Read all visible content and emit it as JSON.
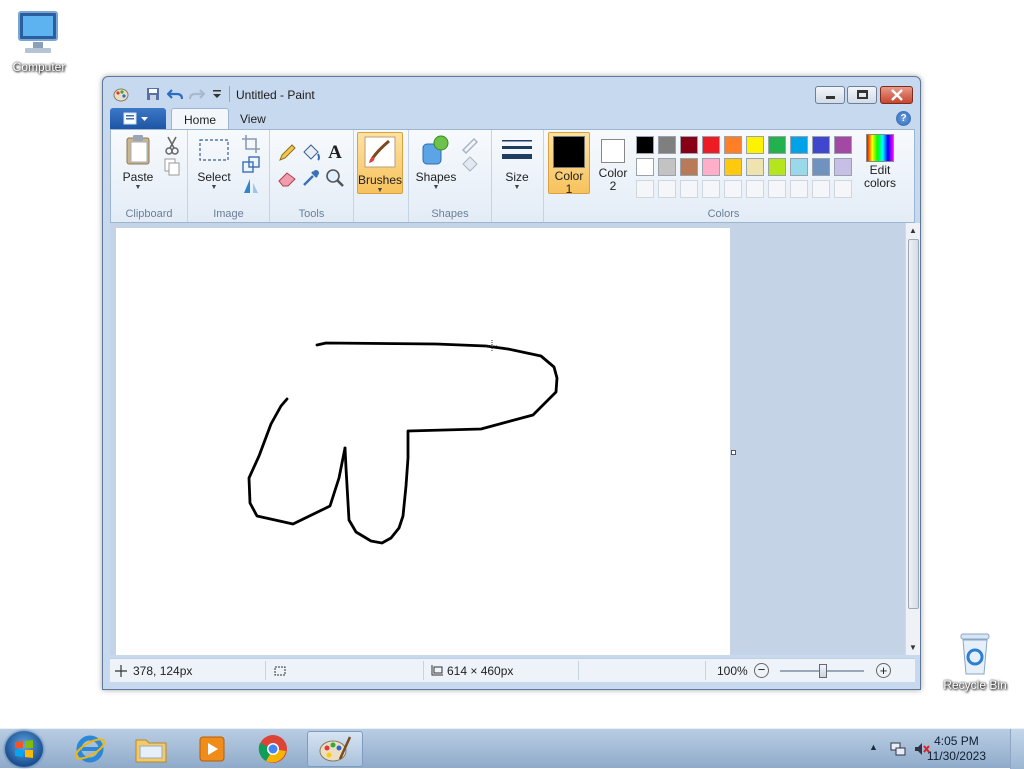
{
  "desktop": {
    "icons": [
      {
        "label": "Computer"
      },
      {
        "label": "Recycle Bin"
      }
    ]
  },
  "window": {
    "title": "Untitled - Paint",
    "tabs": [
      {
        "label": "Home",
        "active": true
      },
      {
        "label": "View",
        "active": false
      }
    ],
    "help": "?"
  },
  "ribbon": {
    "clipboard": {
      "paste": "Paste",
      "group": "Clipboard"
    },
    "image": {
      "select": "Select",
      "group": "Image"
    },
    "tools": {
      "group": "Tools"
    },
    "brushes": {
      "label": "Brushes"
    },
    "shapes": {
      "label": "Shapes",
      "group": "Shapes"
    },
    "size": {
      "label": "Size"
    },
    "colors": {
      "color1": "Color\n1",
      "color2": "Color\n2",
      "color1_value": "#000000",
      "color2_value": "#ffffff",
      "edit": "Edit colors",
      "group": "Colors",
      "palette_row1": [
        "#000000",
        "#7f7f7f",
        "#880015",
        "#ed1c24",
        "#ff7f27",
        "#fff200",
        "#22b14c",
        "#00a2e8",
        "#3f48cc",
        "#a349a4"
      ],
      "palette_row2": [
        "#ffffff",
        "#c3c3c3",
        "#b97a57",
        "#ffaec9",
        "#ffc90e",
        "#efe4b0",
        "#b5e61d",
        "#99d9ea",
        "#7092be",
        "#c8bfe7"
      ]
    }
  },
  "status": {
    "cursor_pos": "378, 124px",
    "canvas_size": "614 × 460px",
    "zoom": "100%"
  },
  "taskbar": {
    "time": "4:05 PM",
    "date": "11/30/2023"
  },
  "colors": {
    "accent": "#f7c25d",
    "titlebar": "#c6d9ee"
  }
}
